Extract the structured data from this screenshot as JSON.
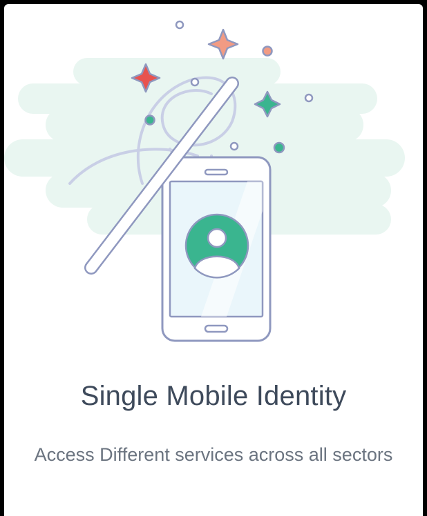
{
  "onboarding": {
    "title": "Single Mobile Identity",
    "subtitle": "Access Different services across all sectors"
  },
  "colors": {
    "background": "#000000",
    "card": "#ffffff",
    "cloud": "#e8f5f0",
    "accent_green": "#3ab58f",
    "accent_red": "#e8534f",
    "accent_peach": "#f29b83",
    "outline": "#9aa4c4",
    "title_text": "#3e4a5b",
    "subtitle_text": "#6b7480"
  },
  "illustration": {
    "icons": [
      "magic-wand-icon",
      "mobile-phone-icon",
      "user-avatar-icon",
      "sparkle-icon"
    ]
  }
}
